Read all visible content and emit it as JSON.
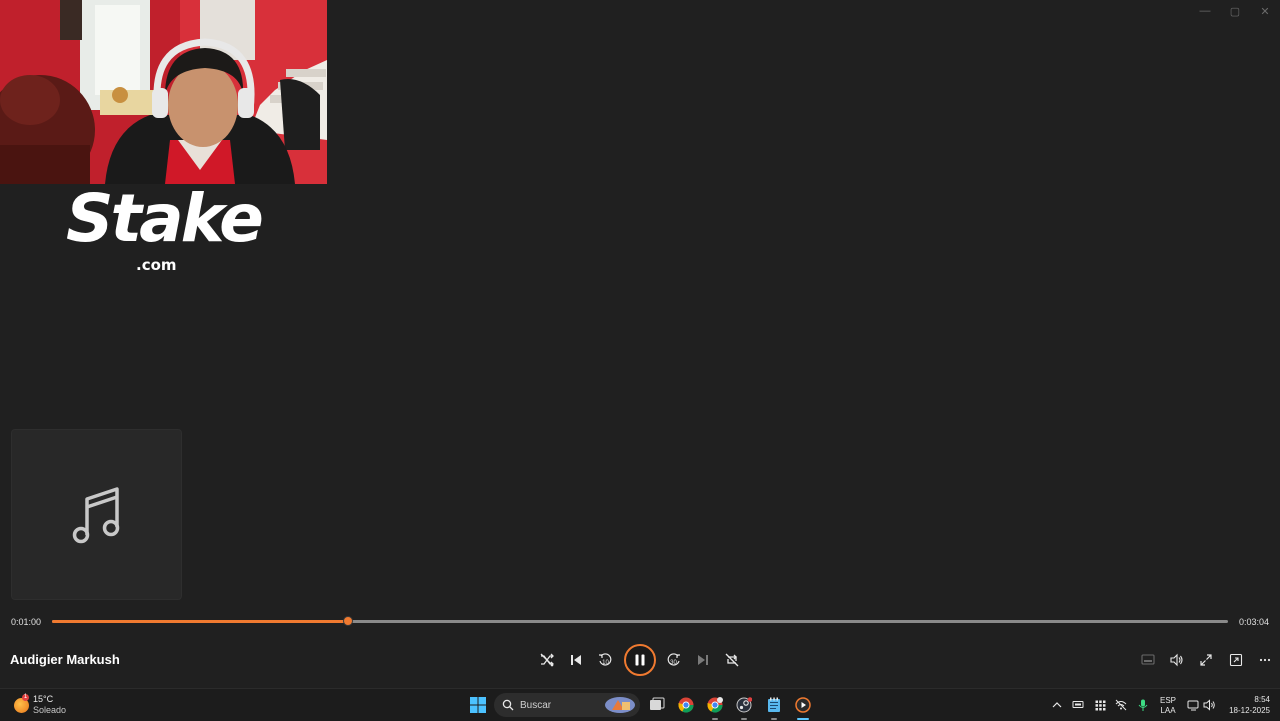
{
  "window_controls": {
    "minimize": "—",
    "maximize": "▢",
    "close": "✕"
  },
  "logo": {
    "word": "Stake",
    "domain": ".com"
  },
  "player": {
    "current_time": "0:01:00",
    "total_time": "0:03:04",
    "progress": 0.2518,
    "song_title": "Audigier Markush",
    "accent": "#f07a30"
  },
  "icons": {
    "shuffle": "shuffle-icon",
    "previous": "previous-icon",
    "rewind": "rewind-10-icon",
    "pause": "pause-icon",
    "forward": "forward-30-icon",
    "next": "next-icon",
    "repeat": "repeat-off-icon",
    "miniplayer": "miniplayer-icon",
    "volume": "volume-icon",
    "fullscreen": "fullscreen-icon",
    "cast": "cast-icon",
    "more": "more-icon"
  },
  "taskbar": {
    "weather": {
      "badge": "1",
      "temp": "15°C",
      "desc": "Soleado"
    },
    "search_placeholder": "Buscar",
    "lang_top": "ESP",
    "lang_bottom": "LAA",
    "time": "8:54",
    "date": "18-12-2025"
  }
}
